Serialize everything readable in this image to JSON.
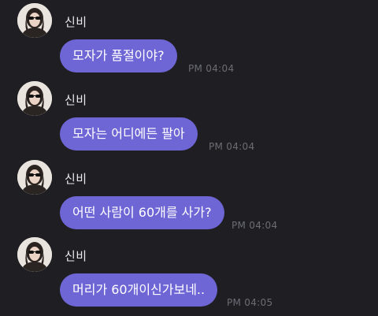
{
  "messages": [
    {
      "sender": "신비",
      "text": "모자가 품절이야?",
      "time": "PM 04:04"
    },
    {
      "sender": "신비",
      "text": "모자는 어디에든 팔아",
      "time": "PM 04:04"
    },
    {
      "sender": "신비",
      "text": "어떤 사람이 60개를 사가?",
      "time": "PM 04:04"
    },
    {
      "sender": "신비",
      "text": "머리가 60개이신가보네..",
      "time": "PM 04:05"
    }
  ],
  "colors": {
    "background": "#1f1f23",
    "bubble": "#6f66d6",
    "sender_text": "#e8e8ee",
    "time_text": "#6c6c75"
  },
  "icons": {
    "avatar": "profile-photo-avatar"
  }
}
